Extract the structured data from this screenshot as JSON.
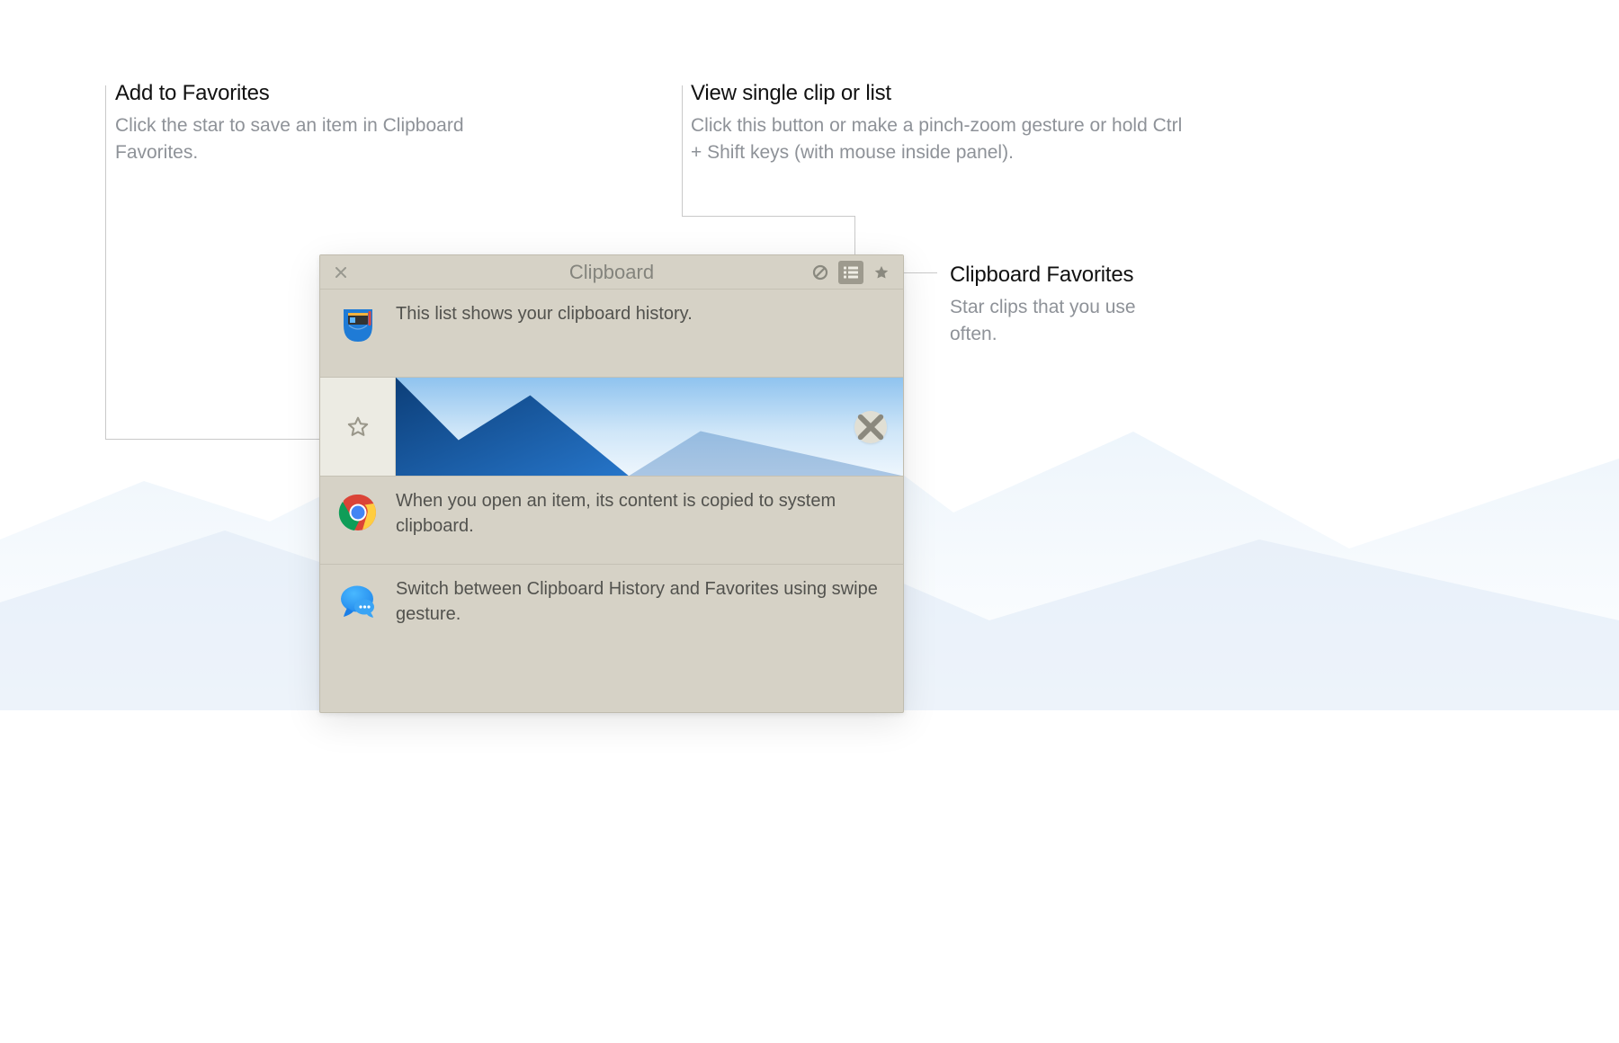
{
  "callouts": {
    "favorites": {
      "title": "Add to Favorites",
      "desc": "Click the star to save an item in Clipboard Favorites."
    },
    "view": {
      "title": "View single clip or list",
      "desc": "Click this button or make a pinch-zoom gesture or hold Ctrl + Shift keys (with mouse inside panel)."
    },
    "starclips": {
      "title": "Clipboard Favorites",
      "desc": "Star clips that you use often."
    }
  },
  "panel": {
    "title": "Clipboard",
    "icons": {
      "close": "close-icon",
      "disable": "disable-icon",
      "list": "list-icon",
      "star": "star-icon"
    },
    "rows": [
      {
        "type": "text",
        "icon": "pocket-app-icon",
        "text": "This list shows your clipboard history."
      },
      {
        "type": "image",
        "star_icon": "star-outline-icon",
        "delete_icon": "close-icon",
        "alt": "Mountain landscape image clip"
      },
      {
        "type": "text",
        "icon": "chrome-app-icon",
        "text": "When you open an item, its content is copied to system clipboard."
      },
      {
        "type": "text",
        "icon": "messages-app-icon",
        "text": "Switch between Clipboard History and Favorites using swipe gesture."
      }
    ]
  }
}
